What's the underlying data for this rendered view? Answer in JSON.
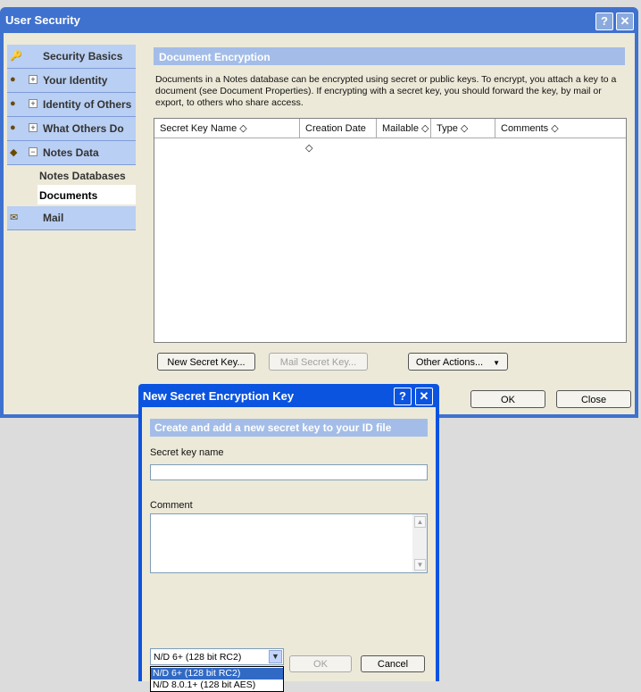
{
  "window": {
    "title": "User Security",
    "help": "?",
    "close": "✕"
  },
  "sidebar": {
    "items": [
      {
        "label": "Security Basics",
        "icon": "key-icon",
        "expander": ""
      },
      {
        "label": "Your Identity",
        "icon": "identity-icon",
        "expander": "+"
      },
      {
        "label": "Identity of Others",
        "icon": "others-icon",
        "expander": "+"
      },
      {
        "label": "What Others Do",
        "icon": "people-icon",
        "expander": "+"
      },
      {
        "label": "Notes Data",
        "icon": "notes-data-icon",
        "expander": "−"
      },
      {
        "label": "Mail",
        "icon": "mail-icon",
        "expander": ""
      }
    ],
    "subitems": [
      "Notes Databases",
      "Documents"
    ]
  },
  "panel": {
    "header": "Document Encryption",
    "description": "Documents in a Notes database can be encrypted using secret or public keys.  To encrypt, you attach a key to a document (see Document Properties).  If encrypting with a secret key, you should forward the key, by mail or export, to others who share access.",
    "columns": [
      "Secret Key Name",
      "Creation Date",
      "Mailable",
      "Type",
      "Comments"
    ],
    "sort_glyph": "◇",
    "buttons": {
      "new": "New Secret Key...",
      "mail": "Mail Secret Key...",
      "other": "Other Actions...",
      "other_arrow": "▼",
      "ok": "OK",
      "close": "Close"
    }
  },
  "dialog": {
    "title": "New Secret Encryption Key",
    "help": "?",
    "close": "✕",
    "header": "Create and add a new secret key to your ID file",
    "name_label": "Secret key name",
    "name_value": "",
    "comment_label": "Comment",
    "comment_value": "",
    "select_value": "N/D 6+ (128 bit RC2)",
    "options": [
      "N/D 6+ (128 bit RC2)",
      "N/D 8.0.1+ (128 bit AES)"
    ],
    "ok": "OK",
    "cancel": "Cancel"
  },
  "colors": {
    "title_bar": "#3f71cf",
    "dialog_title": "#0b54e0",
    "section_header": "#a3bde8",
    "nav_bg": "#b9cff3",
    "highlight": "#316ac5"
  }
}
